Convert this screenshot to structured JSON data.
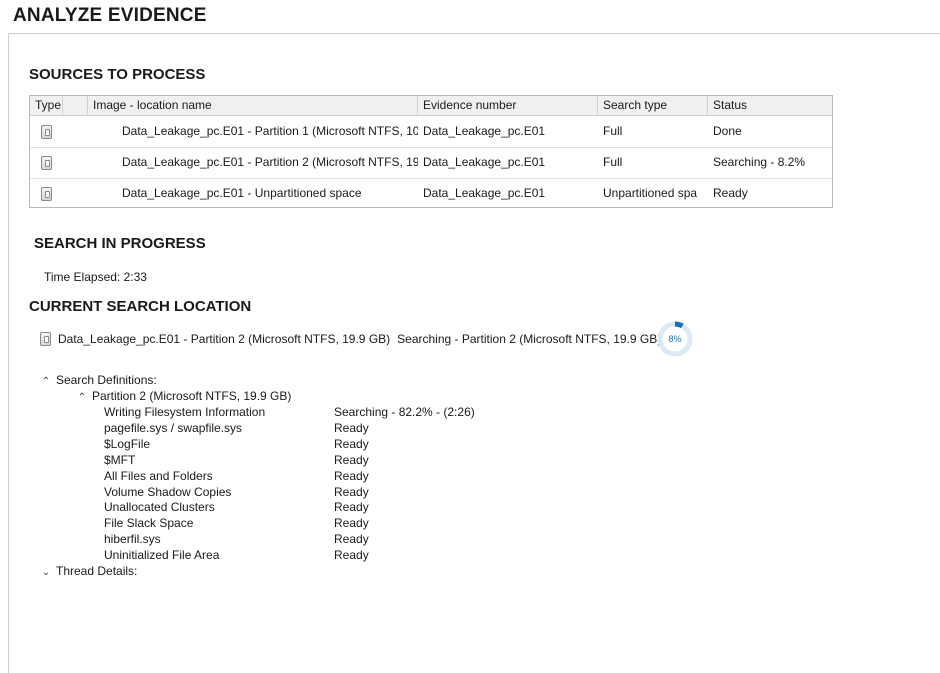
{
  "page": {
    "title": "ANALYZE EVIDENCE"
  },
  "sources": {
    "title": "SOURCES TO PROCESS",
    "columns": [
      "Type",
      "",
      "Image - location name",
      "Evidence number",
      "Search type",
      "Status"
    ],
    "rows": [
      {
        "icon": "drive-icon",
        "name": "Data_Leakage_pc.E01 - Partition 1 (Microsoft NTFS, 100",
        "evidence": "Data_Leakage_pc.E01",
        "search_type": "Full",
        "status": "Done"
      },
      {
        "icon": "drive-icon",
        "name": "Data_Leakage_pc.E01 - Partition 2 (Microsoft NTFS, 19.9",
        "evidence": "Data_Leakage_pc.E01",
        "search_type": "Full",
        "status": "Searching - 8.2%"
      },
      {
        "icon": "drive-icon",
        "name": "Data_Leakage_pc.E01 - Unpartitioned space",
        "evidence": "Data_Leakage_pc.E01",
        "search_type": "Unpartitioned spa",
        "status": "Ready"
      }
    ]
  },
  "search_progress": {
    "title": "SEARCH IN PROGRESS",
    "elapsed_label": "Time Elapsed:",
    "elapsed_value": "2:33"
  },
  "current_location": {
    "title": "CURRENT SEARCH LOCATION",
    "icon": "drive-icon",
    "name": "Data_Leakage_pc.E01 - Partition 2 (Microsoft NTFS, 19.9 GB)",
    "status": "Searching - Partition 2 (Microsoft NTFS, 19.9 GB)",
    "progress_label": "8%",
    "progress_fraction": 0.082,
    "progress_color": "#1a6fb0",
    "progress_track_color": "#dce9f5"
  },
  "tree": {
    "definitions_label": "Search Definitions:",
    "partition_label": "Partition 2 (Microsoft NTFS, 19.9 GB)",
    "items": [
      {
        "name": "Writing Filesystem Information",
        "status": "Searching - 82.2% - (2:26)"
      },
      {
        "name": "pagefile.sys / swapfile.sys",
        "status": "Ready"
      },
      {
        "name": "$LogFile",
        "status": "Ready"
      },
      {
        "name": "$MFT",
        "status": "Ready"
      },
      {
        "name": "All Files and Folders",
        "status": "Ready"
      },
      {
        "name": "Volume Shadow Copies",
        "status": "Ready"
      },
      {
        "name": "Unallocated Clusters",
        "status": "Ready"
      },
      {
        "name": "File Slack Space",
        "status": "Ready"
      },
      {
        "name": "hiberfil.sys",
        "status": "Ready"
      },
      {
        "name": "Uninitialized File Area",
        "status": "Ready"
      }
    ],
    "thread_label": "Thread Details:"
  }
}
